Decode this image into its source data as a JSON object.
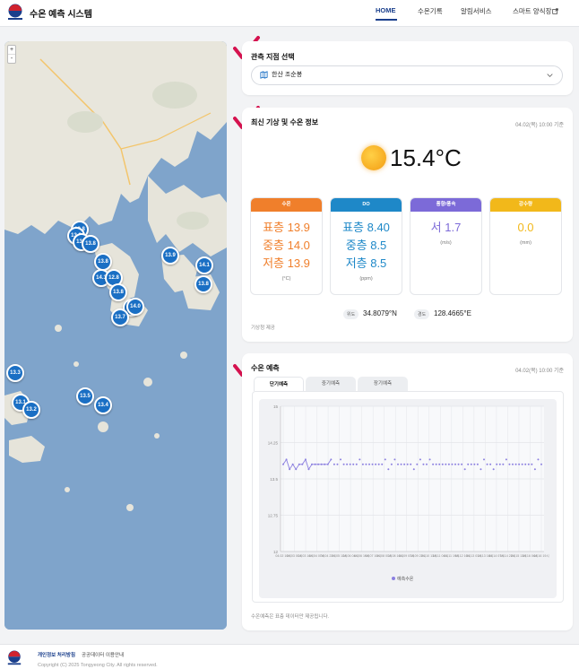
{
  "header": {
    "app_title": "수온 예측 시스템",
    "nav": [
      {
        "label": "HOME",
        "active": true
      },
      {
        "label": "수온기록",
        "active": false
      },
      {
        "label": "알림서비스",
        "active": false
      },
      {
        "label": "스마트 양식장",
        "active": false
      }
    ]
  },
  "map": {
    "zoom_in": "+",
    "zoom_out": "-",
    "markers": [
      "13.8",
      "13.8",
      "13.8",
      "13.8",
      "13.8",
      "14.3",
      "12.8",
      "13.8",
      "13.9",
      "14.1",
      "13.8",
      "13.8",
      "14.0",
      "13.7",
      "13.3",
      "13.5",
      "13.4",
      "13.1",
      "13.2"
    ]
  },
  "station": {
    "title": "관측 지점 선택",
    "selected": "한산 조순봉",
    "icon": "map-icon"
  },
  "weather": {
    "title": "최신 기상 및 수온 정보",
    "timestamp": "04.02(목) 10:00 기준",
    "temperature": "15.4°C",
    "icon": "sun-icon",
    "cards": [
      {
        "header": "수온",
        "color": "#f07f2b",
        "value_color": "#f07f2b",
        "values": [
          "표층 13.9",
          "중층 14.0",
          "저층 13.9"
        ],
        "unit": "(°C)"
      },
      {
        "header": "DO",
        "color": "#1e88c8",
        "value_color": "#1e88c8",
        "values": [
          "표층 8.40",
          "중층 8.5",
          "저층 8.5"
        ],
        "unit": "(ppm)"
      },
      {
        "header": "풍향/풍속",
        "color": "#7c6ad8",
        "value_color": "#7c6ad8",
        "values": [
          "서 1.7"
        ],
        "unit": "(m/s)"
      },
      {
        "header": "강수량",
        "color": "#f2b81a",
        "value_color": "#f2b81a",
        "values": [
          "0.0"
        ],
        "unit": "(mm)"
      }
    ],
    "lat_label": "위도",
    "lat_value": "34.8079°N",
    "lon_label": "경도",
    "lon_value": "128.4665°E",
    "source": "기상청 제공"
  },
  "forecast": {
    "title": "수온 예측",
    "timestamp": "04.02(목) 10:00 기준",
    "tabs": [
      {
        "label": "단기예측",
        "active": true
      },
      {
        "label": "중기예측",
        "active": false
      },
      {
        "label": "장기예측",
        "active": false
      }
    ],
    "note": "수온예측은 표층 데이터만 제공됩니다."
  },
  "chart_data": {
    "type": "scatter",
    "x": [
      "04.02 10시",
      "04.03 01시",
      "04.03 16시",
      "04.04 07시",
      "04.04 22시",
      "04.05 13시",
      "04.06 04시",
      "04.06 19시",
      "04.07 10시",
      "04.08 01시",
      "04.08 16시",
      "04.09 07시",
      "04.09 22시",
      "04.10 13시",
      "04.11 04시",
      "04.11 19시",
      "04.12 10시",
      "04.13 01시",
      "04.13 16시",
      "04.14 07시",
      "04.14 22시",
      "04.15 13시",
      "04.16 04시",
      "04.16 19시"
    ],
    "yticks": [
      "15",
      "14.25",
      "13.5",
      "12.75",
      "12"
    ],
    "ylim": [
      12,
      15
    ],
    "series": [
      {
        "name": "예측수온",
        "color": "#8b7fe0",
        "values": [
          13.8,
          13.9,
          13.7,
          13.8,
          13.7,
          13.8,
          13.8,
          13.9,
          13.7,
          13.8,
          13.8,
          13.8,
          13.8,
          13.8,
          13.8,
          13.9,
          13.8,
          13.8,
          13.9,
          13.8,
          13.8,
          13.8,
          13.8,
          13.8,
          13.9,
          13.8,
          13.8,
          13.8,
          13.8,
          13.8,
          13.8,
          13.8,
          13.9,
          13.7,
          13.8,
          13.9,
          13.8,
          13.8,
          13.8,
          13.8,
          13.8,
          13.7,
          13.8,
          13.9,
          13.8,
          13.8,
          13.9,
          13.8,
          13.8,
          13.8,
          13.8,
          13.8,
          13.8,
          13.8,
          13.8,
          13.8,
          13.8,
          13.7,
          13.8,
          13.8,
          13.8,
          13.8,
          13.7,
          13.9,
          13.8,
          13.8,
          13.7,
          13.8,
          13.8,
          13.8,
          13.9,
          13.8,
          13.8,
          13.8,
          13.8,
          13.8,
          13.8,
          13.8,
          13.8,
          13.7,
          13.9,
          13.8
        ]
      }
    ],
    "legend": "bottom"
  },
  "footer": {
    "links": [
      "개인정보 처리방침",
      "공공데이터 이용안내"
    ],
    "copyright": "Copyright (C) 2025 Tongyeong City. All rights reserved."
  }
}
